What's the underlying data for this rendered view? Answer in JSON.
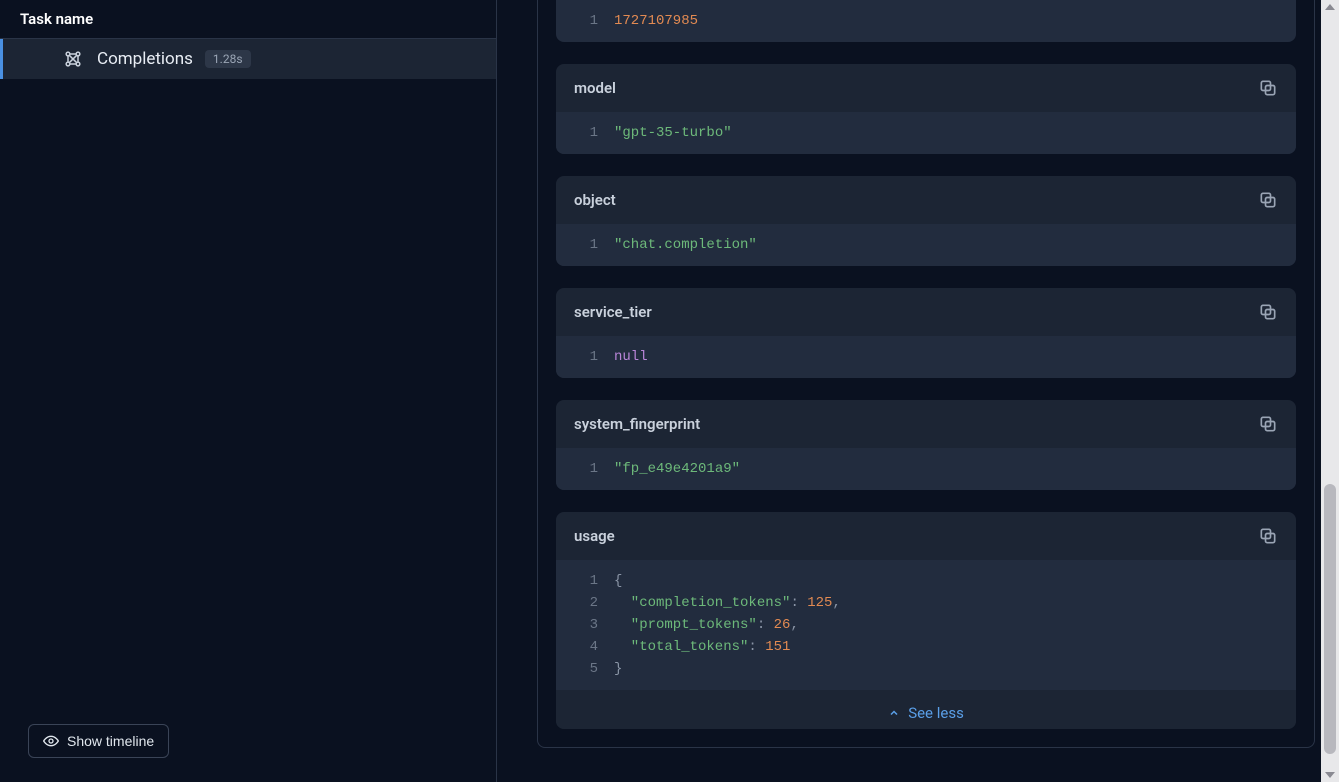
{
  "sidebar": {
    "header": "Task name",
    "task": {
      "label": "Completions",
      "timing": "1.28s"
    },
    "show_timeline": "Show timeline"
  },
  "cards": {
    "created": {
      "value": "1727107985"
    },
    "model": {
      "title": "model",
      "value": "\"gpt-35-turbo\""
    },
    "object": {
      "title": "object",
      "value": "\"chat.completion\""
    },
    "service_tier": {
      "title": "service_tier",
      "value": "null"
    },
    "system_fingerprint": {
      "title": "system_fingerprint",
      "value": "\"fp_e49e4201a9\""
    },
    "usage": {
      "title": "usage",
      "completion_tokens_key": "\"completion_tokens\"",
      "completion_tokens_val": "125",
      "prompt_tokens_key": "\"prompt_tokens\"",
      "prompt_tokens_val": "26",
      "total_tokens_key": "\"total_tokens\"",
      "total_tokens_val": "151"
    }
  },
  "see_less": "See less"
}
